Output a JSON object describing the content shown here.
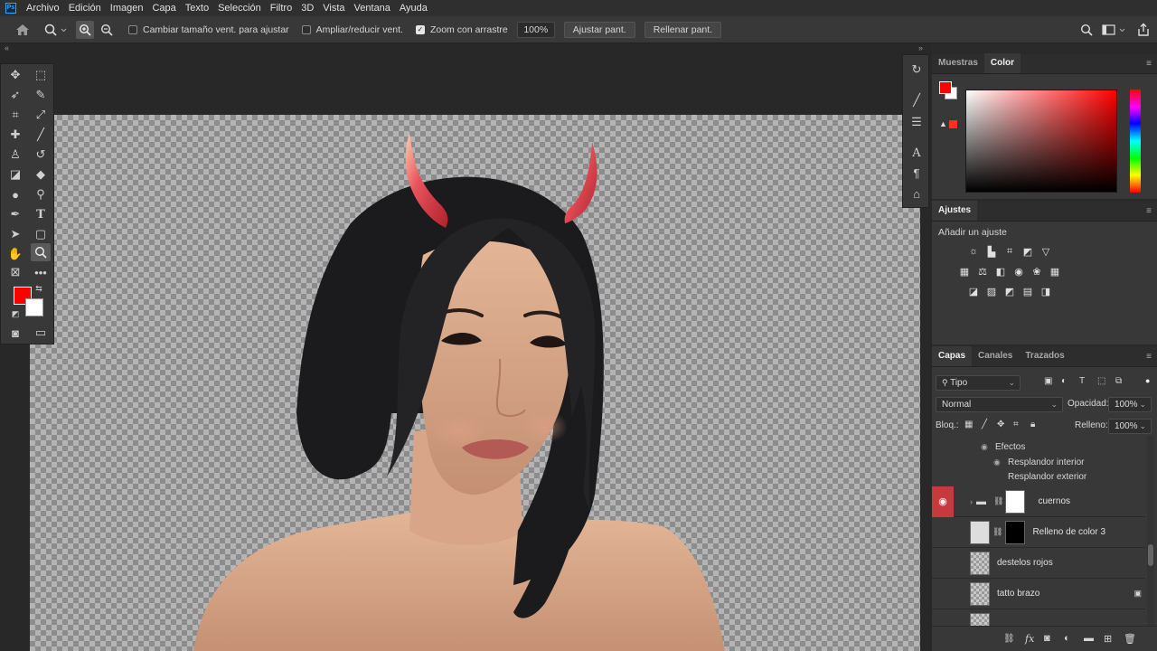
{
  "menubar": {
    "logo": "Ps",
    "items": [
      "Archivo",
      "Edición",
      "Imagen",
      "Capa",
      "Texto",
      "Selección",
      "Filtro",
      "3D",
      "Vista",
      "Ventana",
      "Ayuda"
    ]
  },
  "options": {
    "resize_windows": "Cambiar tamaño vent. para ajustar",
    "zoom_all": "Ampliar/reducir vent.",
    "scrubby_zoom": "Zoom con arrastre",
    "zoom_value": "100%",
    "fit_screen": "Ajustar pant.",
    "fill_screen": "Rellenar pant."
  },
  "colors": {
    "foreground": "#ff0000",
    "background": "#ffffff",
    "accent_eye": "#c8393e"
  },
  "color_panel": {
    "tabs": [
      "Muestras",
      "Color"
    ],
    "active_tab": "Color"
  },
  "adjustments_panel": {
    "title": "Ajustes",
    "add_label": "Añadir un ajuste"
  },
  "layers_panel": {
    "tabs": [
      "Capas",
      "Canales",
      "Trazados"
    ],
    "filter_kind": "Tipo",
    "blend_mode": "Normal",
    "opacity_label": "Opacidad:",
    "opacity_value": "100%",
    "lock_label": "Bloq.:",
    "fill_label": "Relleno:",
    "fill_value": "100%",
    "effects_label": "Efectos",
    "effects": [
      "Resplandor interior",
      "Resplandor exterior"
    ],
    "layers": [
      {
        "name": "cuernos",
        "type": "group",
        "visible": true
      },
      {
        "name": "Relleno de color 3",
        "type": "fill",
        "visible": false
      },
      {
        "name": "destelos rojos",
        "type": "pixel",
        "visible": false
      },
      {
        "name": "tatto brazo",
        "type": "pixel",
        "visible": false
      }
    ]
  }
}
